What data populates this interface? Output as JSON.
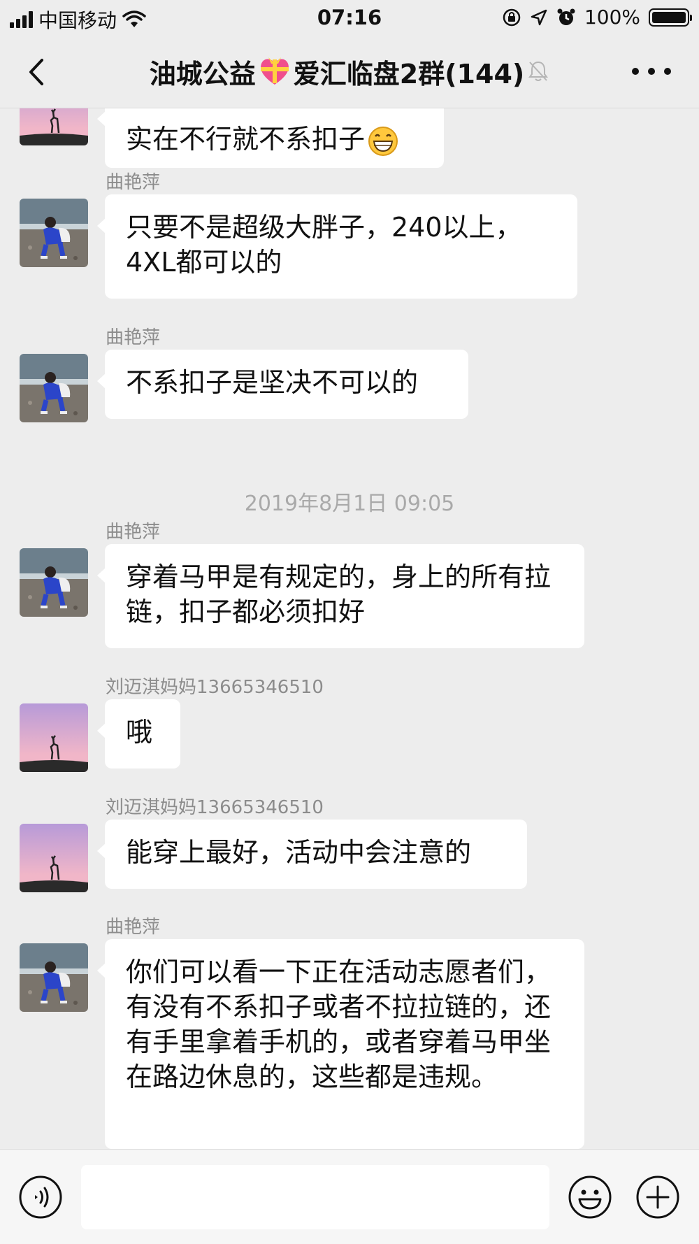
{
  "status_bar": {
    "carrier": "中国移动",
    "time": "07:16",
    "battery": "100%",
    "icons": [
      "signal-icon",
      "wifi-icon",
      "orientation-lock-icon",
      "location-icon",
      "alarm-icon",
      "battery-icon"
    ]
  },
  "nav": {
    "title_prefix": "油城公益",
    "title_suffix": "爱汇临盘2群(144)",
    "icons": [
      "back-icon",
      "heart-gift-emoji-icon",
      "mute-bell-icon",
      "more-icon"
    ]
  },
  "messages": [
    {
      "sender": "",
      "text": "实在不行就不系扣子",
      "avatar": "deer-sunset",
      "emoji": "grin-emoji-icon"
    },
    {
      "sender": "曲艳萍",
      "text": "只要不是超级大胖子，240以上，4XL都可以的",
      "avatar": "woman-beach"
    },
    {
      "sender": "曲艳萍",
      "text": "不系扣子是坚决不可以的",
      "avatar": "woman-beach"
    },
    {
      "sender": "曲艳萍",
      "text": "穿着马甲是有规定的，身上的所有拉链，扣子都必须扣好",
      "avatar": "woman-beach"
    },
    {
      "sender": "刘迈淇妈妈13665346510",
      "text": "哦",
      "avatar": "deer-sunset"
    },
    {
      "sender": "刘迈淇妈妈13665346510",
      "text": "能穿上最好，活动中会注意的",
      "avatar": "deer-sunset"
    },
    {
      "sender": "曲艳萍",
      "text": "你们可以看一下正在活动志愿者们，有没有不系扣子或者不拉拉链的，还有手里拿着手机的，或者穿着马甲坐在路边休息的，这些都是违规。",
      "avatar": "woman-beach"
    }
  ],
  "timestamp": "2019年8月1日 09:05",
  "input_bar": {
    "value": "",
    "icons": [
      "voice-icon",
      "emoji-icon",
      "plus-icon"
    ]
  }
}
